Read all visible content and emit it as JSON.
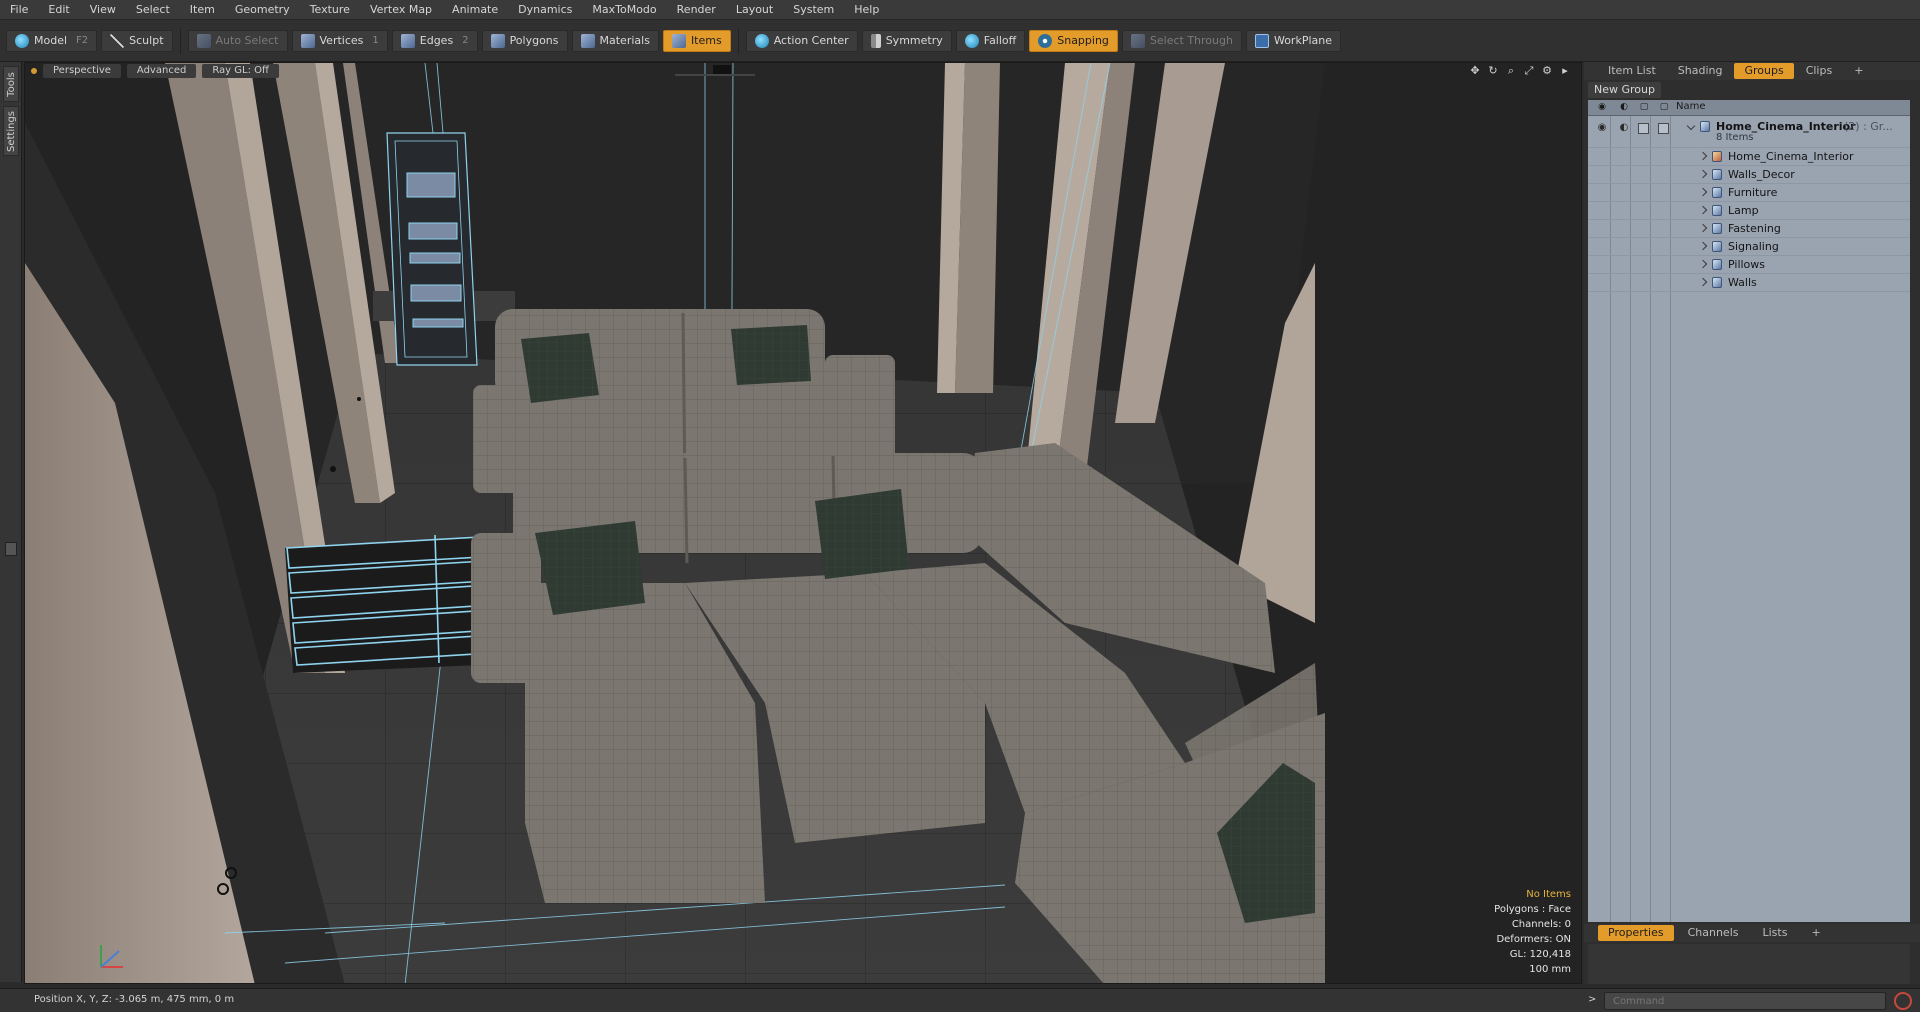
{
  "menu": [
    "File",
    "Edit",
    "View",
    "Select",
    "Item",
    "Geometry",
    "Texture",
    "Vertex Map",
    "Animate",
    "Dynamics",
    "MaxToModo",
    "Render",
    "Layout",
    "System",
    "Help"
  ],
  "toolbar": {
    "model": "Model",
    "model_key": "F2",
    "sculpt": "Sculpt",
    "auto_select": "Auto Select",
    "vertices": "Vertices",
    "vertices_key": "1",
    "edges": "Edges",
    "edges_key": "2",
    "polygons": "Polygons",
    "materials": "Materials",
    "items": "Items",
    "action_center": "Action Center",
    "symmetry": "Symmetry",
    "falloff": "Falloff",
    "snapping": "Snapping",
    "select_through": "Select Through",
    "workplane": "WorkPlane"
  },
  "lefttabs": [
    "Tools",
    "Settings"
  ],
  "viewport": {
    "view": "Perspective",
    "mode": "Advanced",
    "raygl": "Ray GL: Off",
    "info": {
      "items": "No Items",
      "polygons": "Polygons : Face",
      "channels": "Channels: 0",
      "deformers": "Deformers: ON",
      "gl": "GL: 120,418",
      "scale": "100 mm"
    }
  },
  "rightpanel": {
    "tabs": [
      "Item List",
      "Shading",
      "Groups",
      "Clips"
    ],
    "active_tab": "Groups",
    "new_group": "New Group",
    "column_name": "Name",
    "root": {
      "label": "Home_Cinema_Interior",
      "suffix": "(2) : Gr...",
      "sub": "8 Items"
    },
    "children": [
      "Home_Cinema_Interior",
      "Walls_Decor",
      "Furniture",
      "Lamp",
      "Fastening",
      "Signaling",
      "Pillows",
      "Walls"
    ],
    "bottom_tabs": [
      "Properties",
      "Channels",
      "Lists"
    ],
    "bottom_active": "Properties"
  },
  "status": {
    "position": "Position X, Y, Z:   -3.065 m, 475 mm, 0 m",
    "command_placeholder": "Command",
    "prompt": ">"
  },
  "colors": {
    "accent": "#e39b2a",
    "wire": "#8fd3ee",
    "sofa": "#7b766f",
    "pillow": "#2f3a33"
  }
}
